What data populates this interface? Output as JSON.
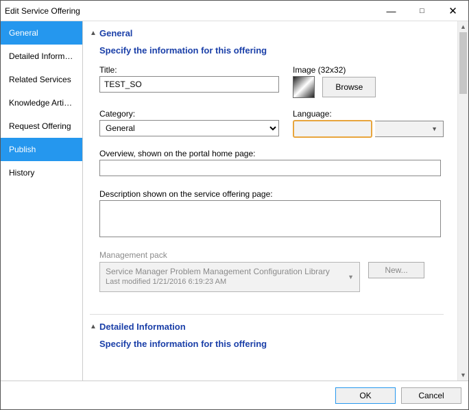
{
  "window": {
    "title": "Edit Service Offering"
  },
  "sidebar": {
    "items": [
      {
        "label": "General",
        "selected": true
      },
      {
        "label": "Detailed Informa...",
        "selected": false
      },
      {
        "label": "Related Services",
        "selected": false
      },
      {
        "label": "Knowledge Artic...",
        "selected": false
      },
      {
        "label": "Request Offering",
        "selected": false
      },
      {
        "label": "Publish",
        "selected": true
      },
      {
        "label": "History",
        "selected": false
      }
    ]
  },
  "sections": {
    "general": {
      "header": "General",
      "sub": "Specify the information for this offering",
      "title_label": "Title:",
      "title_value": "TEST_SO",
      "image_label": "Image (32x32)",
      "browse_label": "Browse",
      "category_label": "Category:",
      "category_value": "General",
      "language_label": "Language:",
      "language_value": "",
      "overview_label": "Overview, shown on the portal home page:",
      "overview_value": "",
      "description_label": "Description shown on the service offering page:",
      "description_value": "",
      "mgmt_label": "Management pack",
      "mgmt_line1": "Service Manager Problem Management Configuration Library",
      "mgmt_line2": "Last modified  1/21/2016 6:19:23 AM",
      "new_label": "New..."
    },
    "detailed": {
      "header": "Detailed Information",
      "sub": "Specify the information for this offering"
    }
  },
  "footer": {
    "ok": "OK",
    "cancel": "Cancel"
  }
}
